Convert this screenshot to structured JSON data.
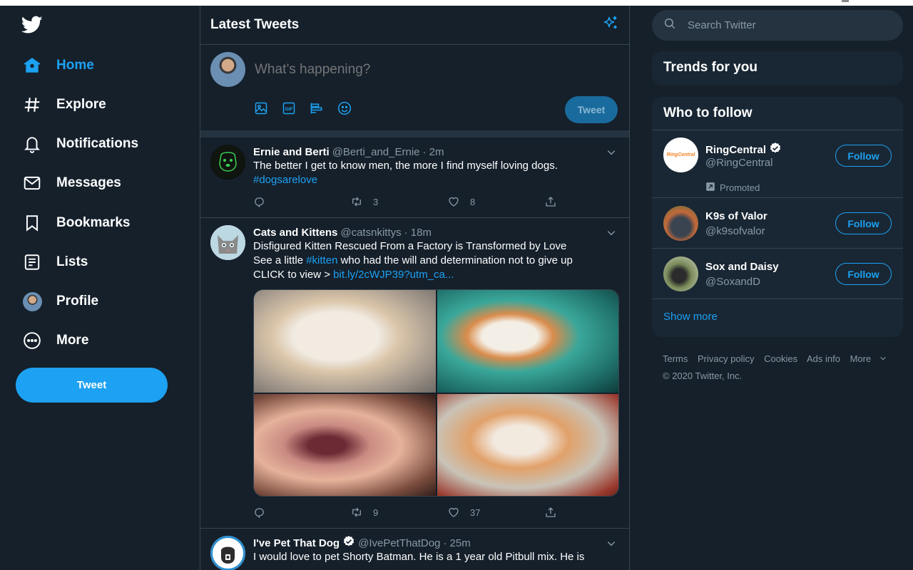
{
  "nav": {
    "items": [
      {
        "label": "Home",
        "icon": "home-icon"
      },
      {
        "label": "Explore",
        "icon": "hashtag-icon"
      },
      {
        "label": "Notifications",
        "icon": "bell-icon"
      },
      {
        "label": "Messages",
        "icon": "envelope-icon"
      },
      {
        "label": "Bookmarks",
        "icon": "bookmark-icon"
      },
      {
        "label": "Lists",
        "icon": "list-icon"
      },
      {
        "label": "Profile",
        "icon": "avatar-icon"
      },
      {
        "label": "More",
        "icon": "more-circle-icon"
      }
    ],
    "tweet_label": "Tweet"
  },
  "header": {
    "title": "Latest Tweets"
  },
  "compose": {
    "placeholder": "What’s happening?",
    "tweet_label": "Tweet"
  },
  "tweets": [
    {
      "name": "Ernie and Berti",
      "handle": "@Berti_and_Ernie",
      "time": "· 2m",
      "text": "The better I get to know men, the more I find myself loving dogs.",
      "hashtag": "#dogsarelove",
      "retweets": "3",
      "likes": "8"
    },
    {
      "name": "Cats and Kittens",
      "handle": "@catsnkittys",
      "time": "· 18m",
      "line1": "Disfigured Kitten Rescued From a Factory is Transformed by Love",
      "line2a": "See a little ",
      "hashtag": "#kitten",
      "line2b": " who had the will and determination not to give up",
      "line3a": "CLICK to view > ",
      "link": "bit.ly/2cWJP39?utm_ca...",
      "retweets": "9",
      "likes": "37"
    },
    {
      "name": "I've Pet That Dog",
      "handle": "@IvePetThatDog",
      "time": "· 25m",
      "text": "I would love to pet Shorty Batman. He is a 1 year old Pitbull mix. He is"
    }
  ],
  "search": {
    "placeholder": "Search Twitter"
  },
  "trends": {
    "title": "Trends for you"
  },
  "who_to_follow": {
    "title": "Who to follow",
    "accounts": [
      {
        "name": "RingCentral",
        "handle": "@RingCentral",
        "promoted": "Promoted",
        "button": "Follow",
        "avatar_text": "RingCentral"
      },
      {
        "name": "K9s of Valor",
        "handle": "@k9sofvalor",
        "button": "Follow"
      },
      {
        "name": "Sox and Daisy",
        "handle": "@SoxandD",
        "button": "Follow"
      }
    ],
    "show_more": "Show more"
  },
  "footer": {
    "links": [
      "Terms",
      "Privacy policy",
      "Cookies",
      "Ads info",
      "More"
    ],
    "copyright": "© 2020 Twitter, Inc."
  },
  "colors": {
    "accent": "#1da1f2",
    "background": "#15202b",
    "panel": "#192734",
    "muted": "#8899a6"
  }
}
